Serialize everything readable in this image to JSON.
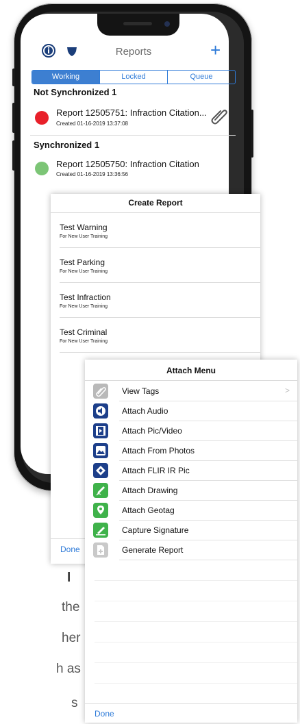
{
  "app": {
    "nav": {
      "title": "Reports",
      "left_icon_1": "info-icon",
      "left_icon_2": "shield-icon",
      "add_icon": "+"
    },
    "segments": [
      {
        "label": "Working",
        "active": true
      },
      {
        "label": "Locked",
        "active": false
      },
      {
        "label": "Queue",
        "active": false
      }
    ],
    "sections": [
      {
        "header": "Not Synchronized 1",
        "reports": [
          {
            "title": "Report 12505751: Infraction Citation...",
            "created": "Created 01-16-2019 13:37:08",
            "status_color": "#e8202a",
            "attachment_icon": "paperclip-icon"
          }
        ]
      },
      {
        "header": "Synchronized 1",
        "reports": [
          {
            "title": "Report 12505750: Infraction Citation",
            "created": "Created 01-16-2019 13:36:56",
            "status_color": "#7cc576"
          }
        ]
      }
    ]
  },
  "create_report": {
    "title": "Create Report",
    "items": [
      {
        "title": "Test Warning",
        "subtitle": "For New User Training"
      },
      {
        "title": "Test Parking",
        "subtitle": "For New User Training"
      },
      {
        "title": "Test Infraction",
        "subtitle": "For New User Training"
      },
      {
        "title": "Test Criminal",
        "subtitle": "For New User Training"
      }
    ],
    "done_label": "Done"
  },
  "attach_menu": {
    "title": "Attach Menu",
    "items": [
      {
        "label": "View Tags",
        "icon": "paperclip-icon",
        "color": "#b9b9b9",
        "chevron": ">"
      },
      {
        "label": "Attach Audio",
        "icon": "speaker-icon",
        "color": "#1d3f8a"
      },
      {
        "label": "Attach Pic/Video",
        "icon": "film-icon",
        "color": "#1d3f8a"
      },
      {
        "label": "Attach From Photos",
        "icon": "photo-icon",
        "color": "#1d3f8a"
      },
      {
        "label": "Attach FLIR IR Pic",
        "icon": "flir-icon",
        "color": "#1d3f8a"
      },
      {
        "label": "Attach Drawing",
        "icon": "pen-icon",
        "color": "#3fb24a"
      },
      {
        "label": "Attach Geotag",
        "icon": "map-pin-icon",
        "color": "#3fb24a"
      },
      {
        "label": "Capture Signature",
        "icon": "signature-icon",
        "color": "#3fb24a"
      },
      {
        "label": "Generate Report",
        "icon": "document-plus-icon",
        "color": "#c9c9c9"
      }
    ],
    "done_label": "Done"
  },
  "background_text": {
    "line1": "l",
    "line2": "the",
    "line3": "her",
    "line4": "h as",
    "line5": "s"
  }
}
